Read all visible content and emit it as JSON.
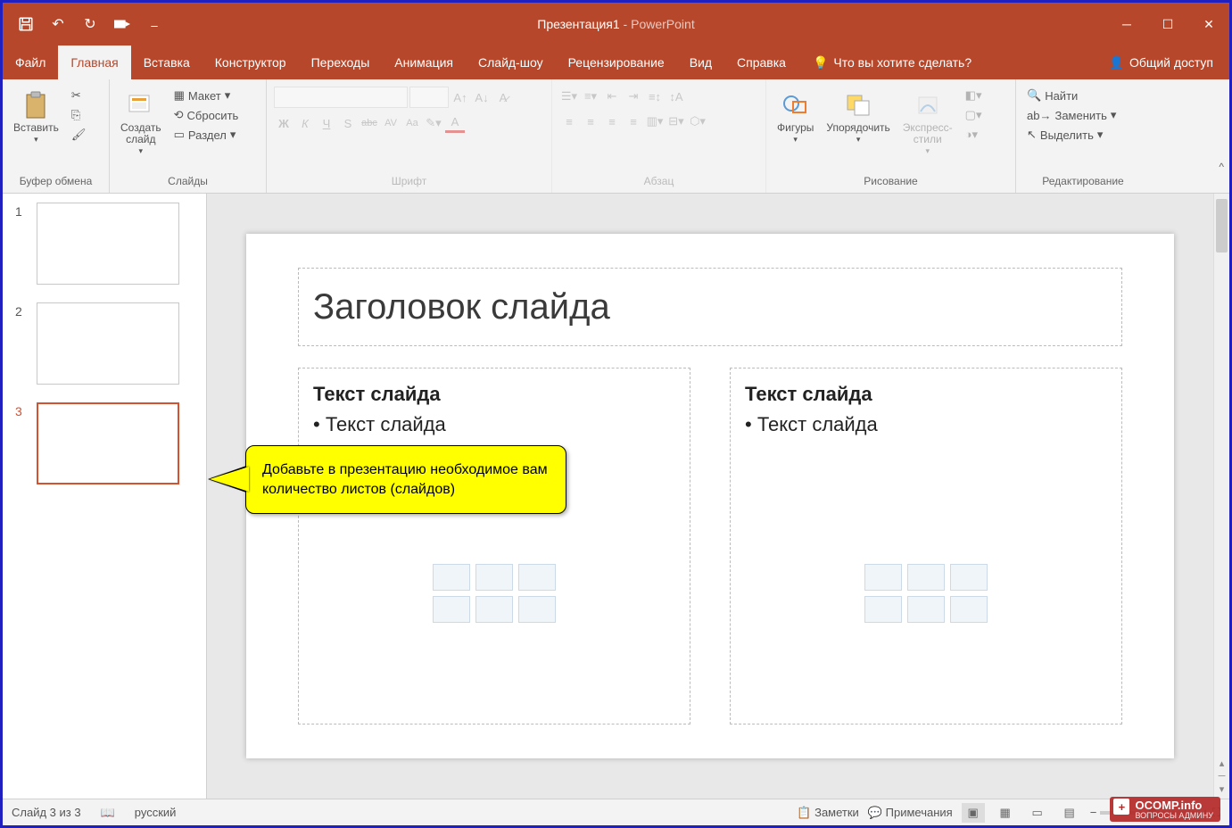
{
  "title": {
    "doc": "Презентация1",
    "sep": " - ",
    "app": "PowerPoint"
  },
  "tabs": [
    "Файл",
    "Главная",
    "Вставка",
    "Конструктор",
    "Переходы",
    "Анимация",
    "Слайд-шоу",
    "Рецензирование",
    "Вид",
    "Справка"
  ],
  "active_tab": 1,
  "tell_me": "Что вы хотите сделать?",
  "share": "Общий доступ",
  "ribbon": {
    "clipboard": {
      "paste": "Вставить",
      "label": "Буфер обмена"
    },
    "slides": {
      "new": "Создать\nслайд",
      "layout": "Макет",
      "reset": "Сбросить",
      "section": "Раздел",
      "label": "Слайды"
    },
    "font": {
      "label": "Шрифт",
      "bold": "Ж",
      "italic": "К",
      "underline": "Ч",
      "strike": "S",
      "abc": "abc",
      "av": "AV",
      "aa": "Aa"
    },
    "paragraph": {
      "label": "Абзац"
    },
    "drawing": {
      "shapes": "Фигуры",
      "arrange": "Упорядочить",
      "styles": "Экспресс-\nстили",
      "label": "Рисование"
    },
    "editing": {
      "find": "Найти",
      "replace": "Заменить",
      "select": "Выделить",
      "label": "Редактирование"
    }
  },
  "thumbs": [
    {
      "n": "1"
    },
    {
      "n": "2"
    },
    {
      "n": "3"
    }
  ],
  "selected_thumb": 2,
  "slide": {
    "title": "Заголовок слайда",
    "left_head": "Текст слайда",
    "left_bullet": "• Текст слайда",
    "right_head": "Текст слайда",
    "right_bullet": "• Текст слайда"
  },
  "callout": "Добавьте в презентацию необходимое вам количество листов (слайдов)",
  "status": {
    "slide": "Слайд 3 из 3",
    "lang": "русский",
    "notes": "Заметки",
    "comments": "Примечания"
  },
  "watermark": {
    "main": "OCOMP.info",
    "sub": "ВОПРОСЫ АДМИНУ"
  }
}
